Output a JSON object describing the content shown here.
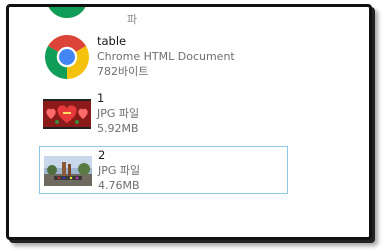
{
  "files": [
    {
      "name": "",
      "type": "",
      "size": "",
      "icon": "chrome-icon-partial",
      "partial_top_text": "파"
    },
    {
      "name": "table",
      "type": "Chrome HTML Document",
      "size": "782바이트",
      "icon": "chrome-icon"
    },
    {
      "name": "1",
      "type": "JPG 파일",
      "size": "5.92MB",
      "icon": "jpg-thumbnail-hearts"
    },
    {
      "name": "2",
      "type": "JPG 파일",
      "size": "4.76MB",
      "icon": "jpg-thumbnail-photo",
      "selected": true
    }
  ],
  "colors": {
    "frame_border": "#111111",
    "selection_border": "#8cc8e6",
    "primary_text": "#1a1a1a",
    "secondary_text": "#6e6e6e",
    "chrome_red": "#db4437",
    "chrome_yellow": "#f4c20d",
    "chrome_green": "#0f9d58",
    "chrome_blue": "#4285f4"
  }
}
